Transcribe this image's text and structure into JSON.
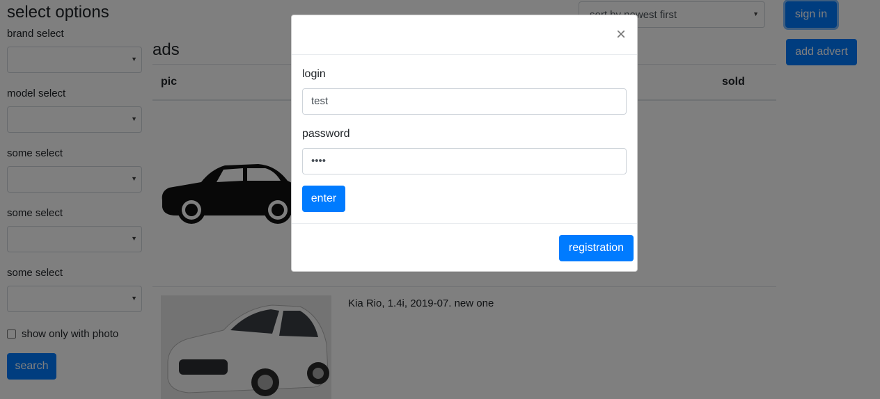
{
  "sidebar": {
    "title": "select options",
    "selects": [
      {
        "label": "brand select"
      },
      {
        "label": "model select"
      },
      {
        "label": "some select"
      },
      {
        "label": "some select"
      },
      {
        "label": "some select"
      }
    ],
    "checkbox_label": "show only with photo",
    "search_label": "search"
  },
  "main": {
    "title": "ads",
    "columns": {
      "pic": "pic",
      "sold": "sold"
    },
    "ads": [
      {
        "text": ""
      },
      {
        "text": "Kia Rio, 1.4i, 2019-07. new one"
      }
    ]
  },
  "header": {
    "sort_value": "sort by newest first",
    "sign_in_label": "sign in",
    "add_advert_label": "add advert"
  },
  "modal": {
    "close_glyph": "×",
    "login_label": "login",
    "login_value": "test",
    "password_label": "password",
    "password_value": "••••",
    "enter_label": "enter",
    "registration_label": "registration"
  },
  "colors": {
    "primary": "#007bff",
    "backdrop": "rgba(0,0,0,0.5)"
  }
}
